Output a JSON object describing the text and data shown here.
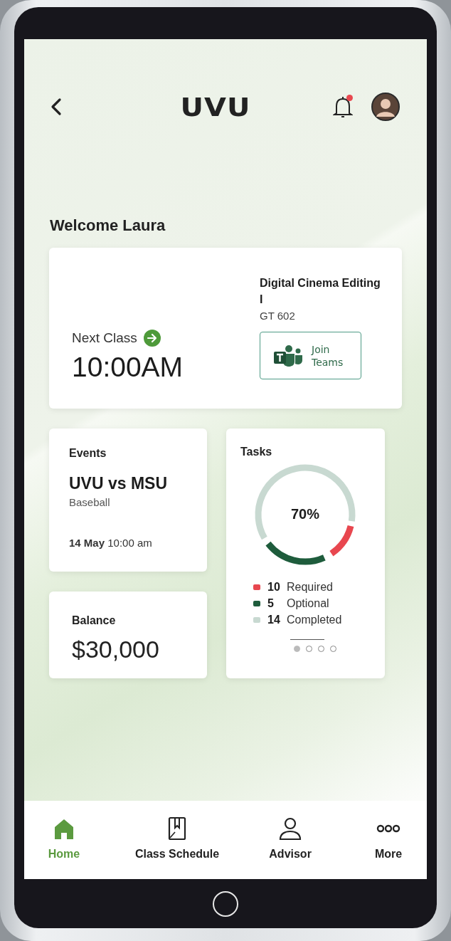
{
  "header": {
    "logo": "UVU",
    "has_notification": true
  },
  "welcome": "Welcome Laura",
  "next_class": {
    "label": "Next Class",
    "time": "10:00AM",
    "course": "Digital Cinema Editing I",
    "room": "GT 602",
    "button": "Join Teams"
  },
  "events": {
    "title": "Events",
    "name": "UVU vs MSU",
    "sport": "Baseball",
    "when": "**14 May** 10:00 am"
  },
  "balance": {
    "title": "Balance",
    "amount": "$30,000"
  },
  "tasks": {
    "title": "Tasks",
    "percent": "70%",
    "legend": [
      {
        "count": "10",
        "label": "Required",
        "color": "#e8474f"
      },
      {
        "count": "5",
        "label": "Optional",
        "color": "#1e5c3c"
      },
      {
        "count": "14",
        "label": "Completed",
        "color": "#c8d9d1"
      }
    ],
    "pages": [
      {
        "selected": true
      },
      {
        "selected": false
      },
      {
        "selected": false
      },
      {
        "selected": false
      }
    ]
  },
  "nav": [
    {
      "kind": "home",
      "label": "Home",
      "selected": true
    },
    {
      "kind": "schedule",
      "label": "Class Schedule",
      "selected": false
    },
    {
      "kind": "advisor",
      "label": "Advisor",
      "selected": false
    },
    {
      "kind": "more",
      "label": "More",
      "selected": false
    }
  ]
}
